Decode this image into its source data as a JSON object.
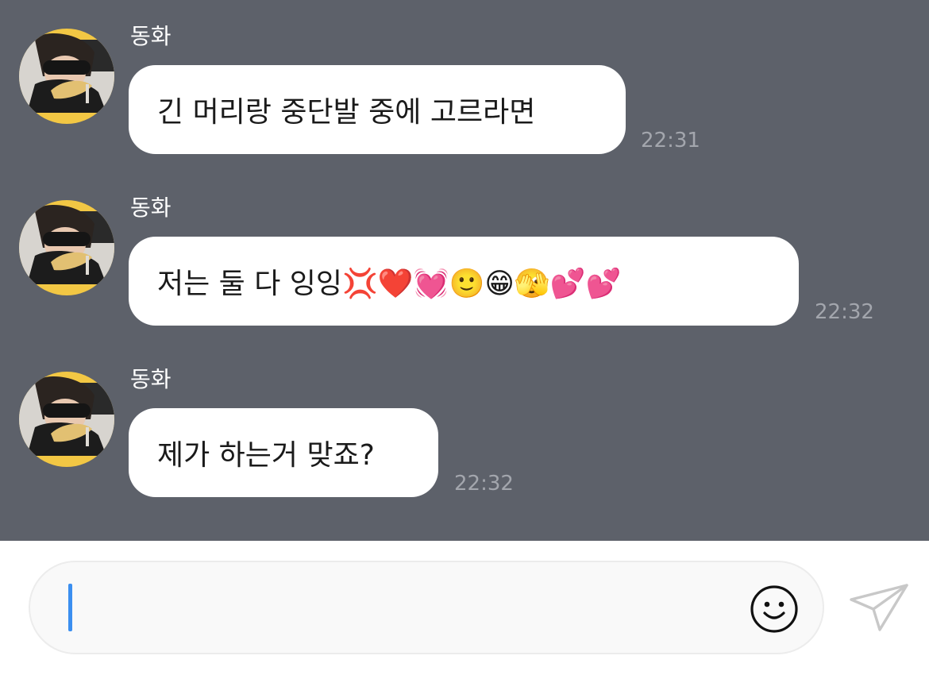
{
  "chat": {
    "messages": [
      {
        "sender": "동화",
        "text": "긴 머리랑 중단발 중에 고르라면",
        "time": "22:31"
      },
      {
        "sender": "동화",
        "text": "저는 둘 다 잉잉💢❤️💓🙂😁🫣💕💕",
        "time": "22:32"
      },
      {
        "sender": "동화",
        "text": "제가 하는거 맞죠?",
        "time": "22:32"
      }
    ]
  },
  "composer": {
    "value": "",
    "emoji_icon": "smiley-icon",
    "send_icon": "paper-plane-icon"
  },
  "colors": {
    "chat_background": "#5d616a",
    "bubble": "#ffffff",
    "timestamp": "#a3a6ad",
    "caret": "#3b8ff0",
    "avatar_ring": "#f2c744"
  }
}
